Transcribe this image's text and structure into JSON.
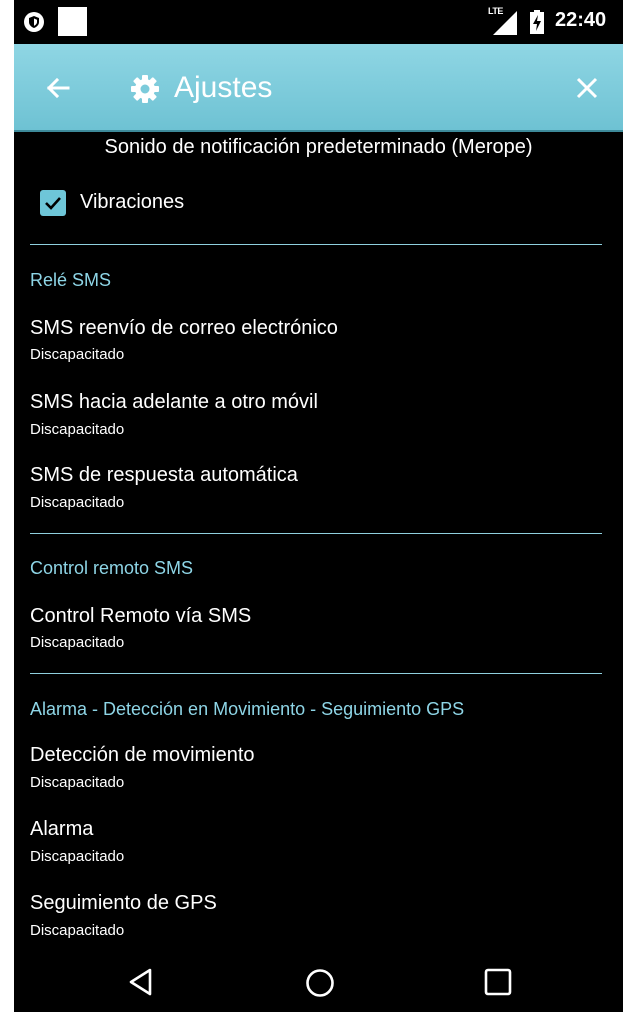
{
  "status_bar": {
    "network": "LTE",
    "time": "22:40"
  },
  "toolbar": {
    "title": "Ajustes",
    "icons": [
      "arrow-back-icon",
      "gear-icon",
      "close-icon"
    ]
  },
  "content": {
    "notification_sound": "Sonido de notificación predeterminado (Merope)",
    "vibrations": {
      "label": "Vibraciones",
      "checked": true
    },
    "sections": [
      {
        "title": "Relé SMS",
        "items": [
          {
            "title": "SMS reenvío de correo electrónico",
            "summary": "Discapacitado"
          },
          {
            "title": "SMS hacia adelante a otro móvil",
            "summary": "Discapacitado"
          },
          {
            "title": "SMS de respuesta automática",
            "summary": "Discapacitado"
          }
        ]
      },
      {
        "title": "Control remoto SMS",
        "items": [
          {
            "title": "Control Remoto vía SMS",
            "summary": "Discapacitado"
          }
        ]
      },
      {
        "title": "Alarma - Detección en Movimiento - Seguimiento GPS",
        "items": [
          {
            "title": "Detección de movimiento",
            "summary": "Discapacitado"
          },
          {
            "title": "Alarma",
            "summary": "Discapacitado"
          },
          {
            "title": "Seguimiento de GPS",
            "summary": "Discapacitado"
          }
        ]
      }
    ]
  },
  "nav_bar": {
    "icons": [
      "nav-back-icon",
      "nav-home-icon",
      "nav-recents-icon"
    ]
  },
  "colors": {
    "toolbar": "#7ccbdb",
    "accent": "#8ed5e6",
    "checkbox": "#6ec6d8",
    "background": "#000000"
  }
}
